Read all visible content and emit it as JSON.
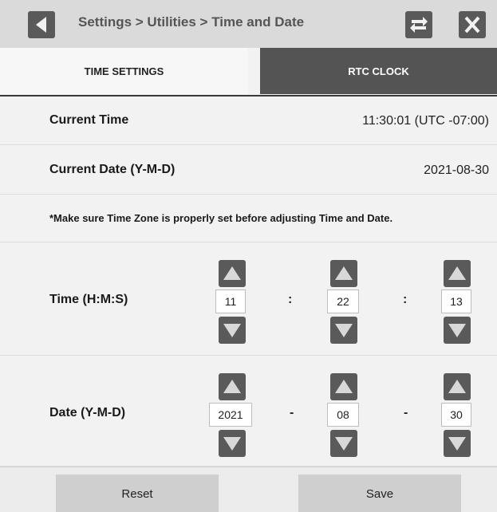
{
  "header": {
    "title": "Settings > Utilities > Time and Date",
    "back_icon": "back-arrow-icon",
    "swap_icon": "swap-icon",
    "close_icon": "close-icon"
  },
  "tabs": [
    {
      "label": "TIME SETTINGS",
      "selected": false
    },
    {
      "label": "RTC CLOCK",
      "selected": true
    }
  ],
  "current_time": {
    "label": "Current Time",
    "value": "11:30:01 (UTC -07:00)"
  },
  "current_date": {
    "label": "Current Date (Y-M-D)",
    "value": "2021-08-30"
  },
  "note": "*Make sure Time Zone is properly set before adjusting Time and Date.",
  "time": {
    "label": "Time (H:M:S)",
    "hours": "11",
    "minutes": "22",
    "seconds": "13",
    "separator": ":"
  },
  "date": {
    "label": "Date (Y-M-D)",
    "year": "2021",
    "month": "08",
    "day": "30",
    "separator": "-"
  },
  "footer": {
    "reset_label": "Reset",
    "save_label": "Save"
  }
}
